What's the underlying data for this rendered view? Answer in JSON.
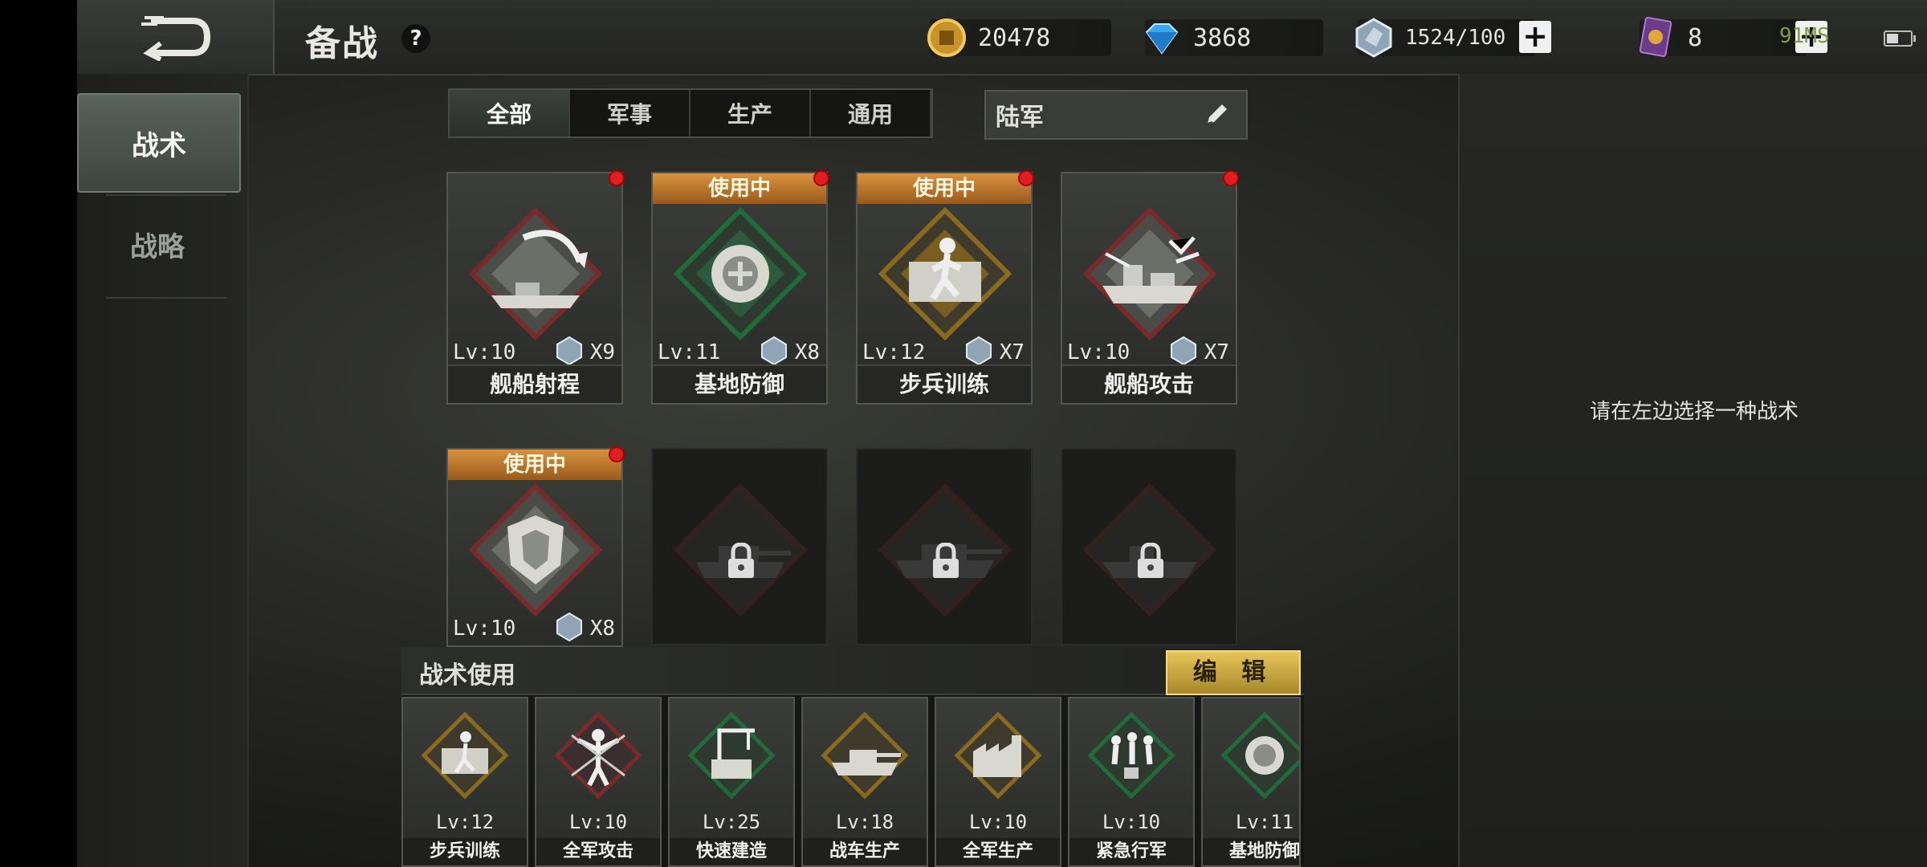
{
  "header": {
    "title": "备战",
    "help": "?"
  },
  "resources": {
    "gold": "20478",
    "diamond": "3868",
    "crystal": "1524/100",
    "cards": "8",
    "plus": "+"
  },
  "status": {
    "ping": "91MS"
  },
  "sidenav": {
    "items": [
      {
        "label": "战术"
      },
      {
        "label": "战略"
      }
    ]
  },
  "filters": {
    "tabs": [
      {
        "label": "全部"
      },
      {
        "label": "军事"
      },
      {
        "label": "生产"
      },
      {
        "label": "通用"
      }
    ],
    "army": "陆军"
  },
  "tactics": [
    {
      "name": "舰船射程",
      "level": "Lv:10",
      "count": "X9",
      "in_use": "",
      "color": "#7a2a2a"
    },
    {
      "name": "基地防御",
      "level": "Lv:11",
      "count": "X8",
      "in_use": "使用中",
      "color": "#1f6b3a"
    },
    {
      "name": "步兵训练",
      "level": "Lv:12",
      "count": "X7",
      "in_use": "使用中",
      "color": "#8a6a1c"
    },
    {
      "name": "舰船攻击",
      "level": "Lv:10",
      "count": "X7",
      "in_use": "",
      "color": "#7a2a2a"
    },
    {
      "name": "",
      "level": "Lv:10",
      "count": "X8",
      "in_use": "使用中",
      "color": "#7a2a2a"
    }
  ],
  "usage": {
    "title": "战术使用",
    "edit": "编 辑",
    "items": [
      {
        "name": "步兵训练",
        "level": "Lv:12",
        "color": "#8a6a1c"
      },
      {
        "name": "全军攻击",
        "level": "Lv:10",
        "color": "#7a2a2a"
      },
      {
        "name": "快速建造",
        "level": "Lv:25",
        "color": "#1f6b3a"
      },
      {
        "name": "战车生产",
        "level": "Lv:18",
        "color": "#8a6a1c"
      },
      {
        "name": "全军生产",
        "level": "Lv:10",
        "color": "#8a6a1c"
      },
      {
        "name": "紧急行军",
        "level": "Lv:10",
        "color": "#1f6b3a"
      },
      {
        "name": "基地防御",
        "level": "Lv:11",
        "color": "#1f6b3a"
      }
    ]
  },
  "detail": {
    "hint": "请在左边选择一种战术"
  }
}
